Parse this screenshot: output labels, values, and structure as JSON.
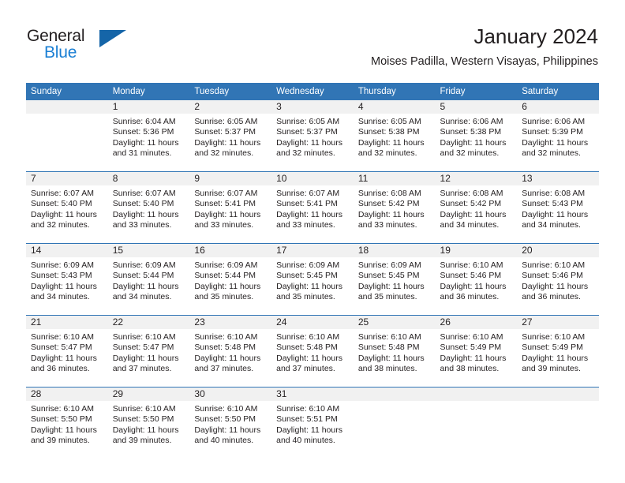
{
  "brand": {
    "name_part1": "General",
    "name_part2": "Blue",
    "accent_color": "#1a7fd4",
    "triangle_color": "#1565a8"
  },
  "header": {
    "title": "January 2024",
    "location": "Moises Padilla, Western Visayas, Philippines"
  },
  "theme": {
    "header_blue": "#3175b5",
    "daynum_band": "#f1f1f1",
    "text": "#231f20"
  },
  "weekday_headers": [
    "Sunday",
    "Monday",
    "Tuesday",
    "Wednesday",
    "Thursday",
    "Friday",
    "Saturday"
  ],
  "weeks": [
    [
      {
        "day": "",
        "sunrise": "",
        "sunset": "",
        "daylight1": "",
        "daylight2": ""
      },
      {
        "day": "1",
        "sunrise": "Sunrise: 6:04 AM",
        "sunset": "Sunset: 5:36 PM",
        "daylight1": "Daylight: 11 hours",
        "daylight2": "and 31 minutes."
      },
      {
        "day": "2",
        "sunrise": "Sunrise: 6:05 AM",
        "sunset": "Sunset: 5:37 PM",
        "daylight1": "Daylight: 11 hours",
        "daylight2": "and 32 minutes."
      },
      {
        "day": "3",
        "sunrise": "Sunrise: 6:05 AM",
        "sunset": "Sunset: 5:37 PM",
        "daylight1": "Daylight: 11 hours",
        "daylight2": "and 32 minutes."
      },
      {
        "day": "4",
        "sunrise": "Sunrise: 6:05 AM",
        "sunset": "Sunset: 5:38 PM",
        "daylight1": "Daylight: 11 hours",
        "daylight2": "and 32 minutes."
      },
      {
        "day": "5",
        "sunrise": "Sunrise: 6:06 AM",
        "sunset": "Sunset: 5:38 PM",
        "daylight1": "Daylight: 11 hours",
        "daylight2": "and 32 minutes."
      },
      {
        "day": "6",
        "sunrise": "Sunrise: 6:06 AM",
        "sunset": "Sunset: 5:39 PM",
        "daylight1": "Daylight: 11 hours",
        "daylight2": "and 32 minutes."
      }
    ],
    [
      {
        "day": "7",
        "sunrise": "Sunrise: 6:07 AM",
        "sunset": "Sunset: 5:40 PM",
        "daylight1": "Daylight: 11 hours",
        "daylight2": "and 32 minutes."
      },
      {
        "day": "8",
        "sunrise": "Sunrise: 6:07 AM",
        "sunset": "Sunset: 5:40 PM",
        "daylight1": "Daylight: 11 hours",
        "daylight2": "and 33 minutes."
      },
      {
        "day": "9",
        "sunrise": "Sunrise: 6:07 AM",
        "sunset": "Sunset: 5:41 PM",
        "daylight1": "Daylight: 11 hours",
        "daylight2": "and 33 minutes."
      },
      {
        "day": "10",
        "sunrise": "Sunrise: 6:07 AM",
        "sunset": "Sunset: 5:41 PM",
        "daylight1": "Daylight: 11 hours",
        "daylight2": "and 33 minutes."
      },
      {
        "day": "11",
        "sunrise": "Sunrise: 6:08 AM",
        "sunset": "Sunset: 5:42 PM",
        "daylight1": "Daylight: 11 hours",
        "daylight2": "and 33 minutes."
      },
      {
        "day": "12",
        "sunrise": "Sunrise: 6:08 AM",
        "sunset": "Sunset: 5:42 PM",
        "daylight1": "Daylight: 11 hours",
        "daylight2": "and 34 minutes."
      },
      {
        "day": "13",
        "sunrise": "Sunrise: 6:08 AM",
        "sunset": "Sunset: 5:43 PM",
        "daylight1": "Daylight: 11 hours",
        "daylight2": "and 34 minutes."
      }
    ],
    [
      {
        "day": "14",
        "sunrise": "Sunrise: 6:09 AM",
        "sunset": "Sunset: 5:43 PM",
        "daylight1": "Daylight: 11 hours",
        "daylight2": "and 34 minutes."
      },
      {
        "day": "15",
        "sunrise": "Sunrise: 6:09 AM",
        "sunset": "Sunset: 5:44 PM",
        "daylight1": "Daylight: 11 hours",
        "daylight2": "and 34 minutes."
      },
      {
        "day": "16",
        "sunrise": "Sunrise: 6:09 AM",
        "sunset": "Sunset: 5:44 PM",
        "daylight1": "Daylight: 11 hours",
        "daylight2": "and 35 minutes."
      },
      {
        "day": "17",
        "sunrise": "Sunrise: 6:09 AM",
        "sunset": "Sunset: 5:45 PM",
        "daylight1": "Daylight: 11 hours",
        "daylight2": "and 35 minutes."
      },
      {
        "day": "18",
        "sunrise": "Sunrise: 6:09 AM",
        "sunset": "Sunset: 5:45 PM",
        "daylight1": "Daylight: 11 hours",
        "daylight2": "and 35 minutes."
      },
      {
        "day": "19",
        "sunrise": "Sunrise: 6:10 AM",
        "sunset": "Sunset: 5:46 PM",
        "daylight1": "Daylight: 11 hours",
        "daylight2": "and 36 minutes."
      },
      {
        "day": "20",
        "sunrise": "Sunrise: 6:10 AM",
        "sunset": "Sunset: 5:46 PM",
        "daylight1": "Daylight: 11 hours",
        "daylight2": "and 36 minutes."
      }
    ],
    [
      {
        "day": "21",
        "sunrise": "Sunrise: 6:10 AM",
        "sunset": "Sunset: 5:47 PM",
        "daylight1": "Daylight: 11 hours",
        "daylight2": "and 36 minutes."
      },
      {
        "day": "22",
        "sunrise": "Sunrise: 6:10 AM",
        "sunset": "Sunset: 5:47 PM",
        "daylight1": "Daylight: 11 hours",
        "daylight2": "and 37 minutes."
      },
      {
        "day": "23",
        "sunrise": "Sunrise: 6:10 AM",
        "sunset": "Sunset: 5:48 PM",
        "daylight1": "Daylight: 11 hours",
        "daylight2": "and 37 minutes."
      },
      {
        "day": "24",
        "sunrise": "Sunrise: 6:10 AM",
        "sunset": "Sunset: 5:48 PM",
        "daylight1": "Daylight: 11 hours",
        "daylight2": "and 37 minutes."
      },
      {
        "day": "25",
        "sunrise": "Sunrise: 6:10 AM",
        "sunset": "Sunset: 5:48 PM",
        "daylight1": "Daylight: 11 hours",
        "daylight2": "and 38 minutes."
      },
      {
        "day": "26",
        "sunrise": "Sunrise: 6:10 AM",
        "sunset": "Sunset: 5:49 PM",
        "daylight1": "Daylight: 11 hours",
        "daylight2": "and 38 minutes."
      },
      {
        "day": "27",
        "sunrise": "Sunrise: 6:10 AM",
        "sunset": "Sunset: 5:49 PM",
        "daylight1": "Daylight: 11 hours",
        "daylight2": "and 39 minutes."
      }
    ],
    [
      {
        "day": "28",
        "sunrise": "Sunrise: 6:10 AM",
        "sunset": "Sunset: 5:50 PM",
        "daylight1": "Daylight: 11 hours",
        "daylight2": "and 39 minutes."
      },
      {
        "day": "29",
        "sunrise": "Sunrise: 6:10 AM",
        "sunset": "Sunset: 5:50 PM",
        "daylight1": "Daylight: 11 hours",
        "daylight2": "and 39 minutes."
      },
      {
        "day": "30",
        "sunrise": "Sunrise: 6:10 AM",
        "sunset": "Sunset: 5:50 PM",
        "daylight1": "Daylight: 11 hours",
        "daylight2": "and 40 minutes."
      },
      {
        "day": "31",
        "sunrise": "Sunrise: 6:10 AM",
        "sunset": "Sunset: 5:51 PM",
        "daylight1": "Daylight: 11 hours",
        "daylight2": "and 40 minutes."
      },
      {
        "day": "",
        "sunrise": "",
        "sunset": "",
        "daylight1": "",
        "daylight2": ""
      },
      {
        "day": "",
        "sunrise": "",
        "sunset": "",
        "daylight1": "",
        "daylight2": ""
      },
      {
        "day": "",
        "sunrise": "",
        "sunset": "",
        "daylight1": "",
        "daylight2": ""
      }
    ]
  ]
}
